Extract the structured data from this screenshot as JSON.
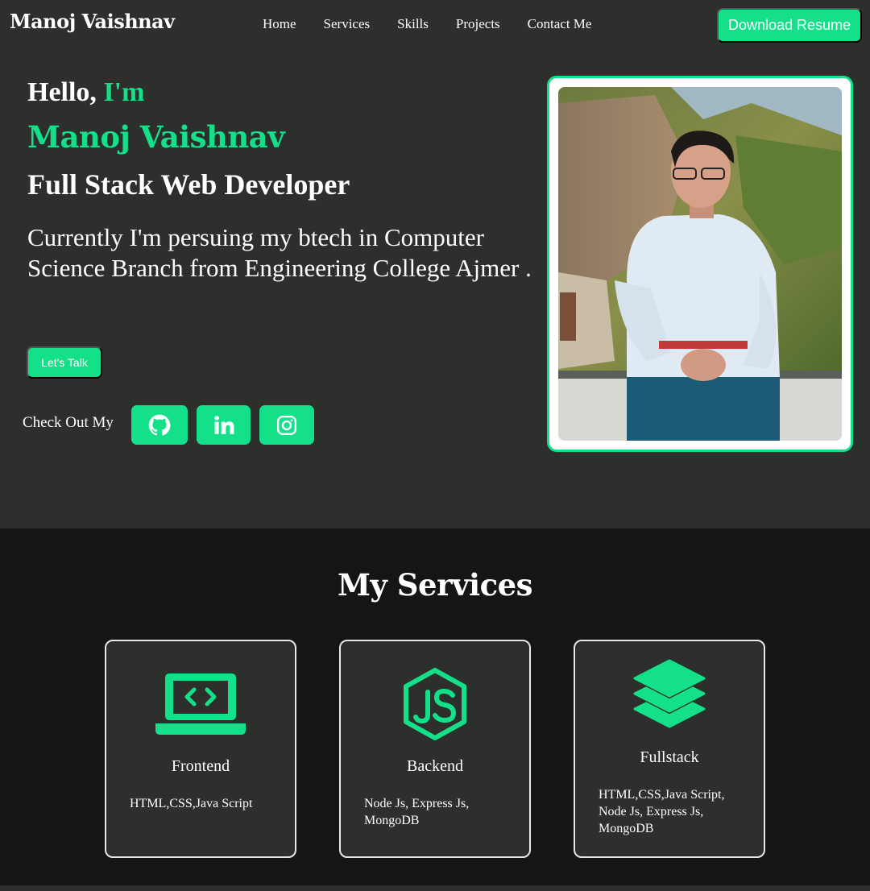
{
  "nav": {
    "brand": "Manoj Vaishnav",
    "links": [
      "Home",
      "Services",
      "Skills",
      "Projects",
      "Contact Me"
    ],
    "resume_label": "Download Resume"
  },
  "hero": {
    "hello": "Hello, ",
    "im": "I'm",
    "name": "Manoj Vaishnav",
    "role": "Full Stack Web Developer",
    "description": "Currently I'm persuing my btech in Computer Science Branch from Engineering College Ajmer .",
    "talk_label": "Let's Talk",
    "check_out_label": "Check Out My",
    "socials": [
      {
        "icon": "github-icon"
      },
      {
        "icon": "linkedin-icon"
      },
      {
        "icon": "instagram-icon"
      }
    ]
  },
  "services": {
    "title": "My Services",
    "cards": [
      {
        "icon": "laptop-code-icon",
        "title": "Frontend",
        "description": "HTML,CSS,Java Script"
      },
      {
        "icon": "nodejs-icon",
        "title": "Backend",
        "description": "Node Js, Express Js, MongoDB"
      },
      {
        "icon": "layers-icon",
        "title": "Fullstack",
        "description": "HTML,CSS,Java Script, Node Js, Express Js, MongoDB"
      }
    ]
  },
  "colors": {
    "accent": "#14e08a",
    "background": "#2c2f2b",
    "services_background": "#151515"
  }
}
